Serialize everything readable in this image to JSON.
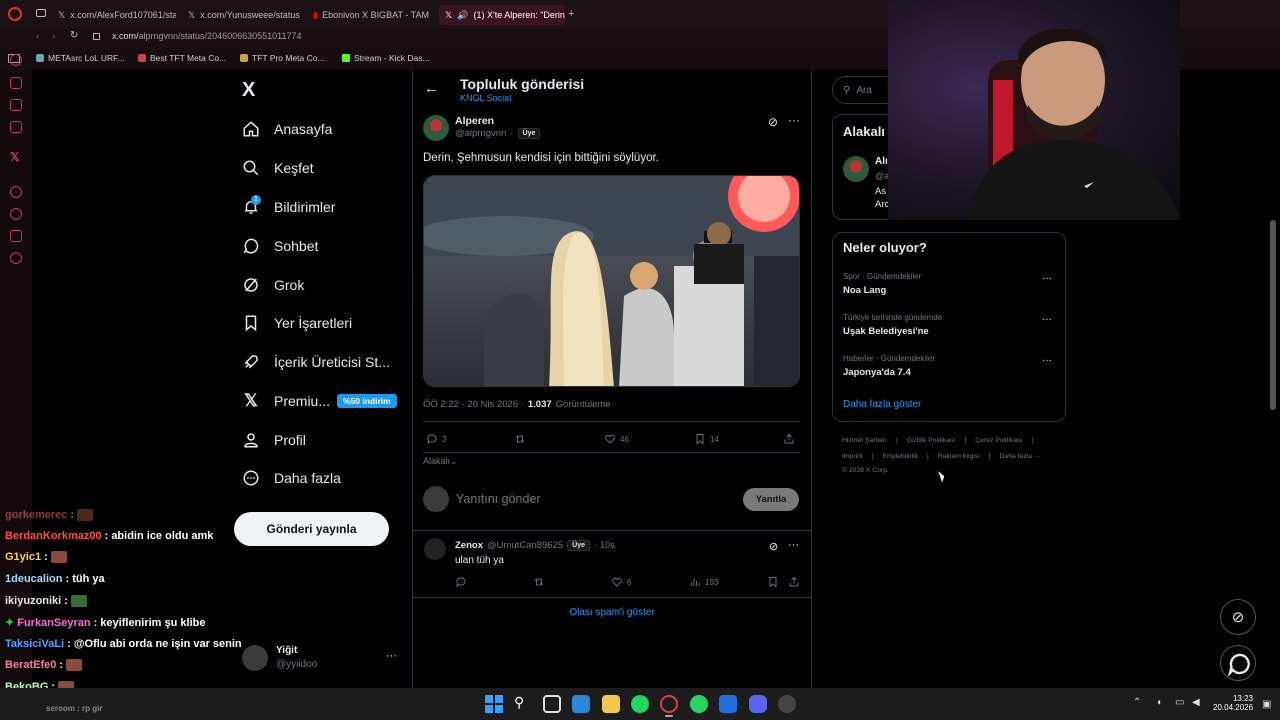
{
  "browser": {
    "tabs": [
      {
        "label": "x.com/AlexFord107061/sta"
      },
      {
        "label": "x.com/Yunusweee/status/"
      },
      {
        "label": "Ebonivon X BIGBAT - TAM"
      },
      {
        "label": "(1) X'te Alperen: \"Derin"
      }
    ],
    "url_prefix": "x.com/",
    "url_path": "alprngvnn/status/2046006630551011774",
    "bookmarks": [
      "METAsrc LoL URF...",
      "Best TFT Meta Co...",
      "TFT Pro Meta Co...",
      "Stream - Kick Das..."
    ]
  },
  "nav": {
    "logo": "X",
    "items": [
      {
        "label": "Anasayfa",
        "icon": "home-icon"
      },
      {
        "label": "Keşfet",
        "icon": "search-icon"
      },
      {
        "label": "Bildirimler",
        "icon": "bell-icon",
        "badge": "1"
      },
      {
        "label": "Sohbet",
        "icon": "chat-icon"
      },
      {
        "label": "Grok",
        "icon": "grok-icon"
      },
      {
        "label": "Yer İşaretleri",
        "icon": "bookmark-icon"
      },
      {
        "label": "İçerik Üreticisi St...",
        "icon": "rocket-icon"
      },
      {
        "label": "Premiu...",
        "icon": "x-icon",
        "badge": "%50 indirim"
      },
      {
        "label": "Profil",
        "icon": "profile-icon"
      },
      {
        "label": "Daha fazla",
        "icon": "more-circle-icon"
      }
    ],
    "post_button": "Gönderi yayınla",
    "account": {
      "name": "Yiğit",
      "handle": "@yyiidoo",
      "more": "···"
    }
  },
  "header": {
    "title": "Topluluk gönderisi",
    "community": "KNGL Social"
  },
  "post": {
    "author": "Alperen",
    "handle": "@alprngvnn",
    "dot": "·",
    "badge": "Üye",
    "text": "Derin, Şehmusun kendisi için bittiğini söylüyor.",
    "time": "ÖÖ 2:22 · 20 Nis 2026 ·",
    "views_count": "1.037",
    "views_label": "Görüntüleme",
    "replies": "3",
    "likes": "46",
    "bookmarks": "14",
    "sort_label": "Alakalı"
  },
  "reply_box": {
    "placeholder": "Yanıtını gönder",
    "button": "Yanıtla"
  },
  "reply": {
    "author": "Zenox",
    "handle": "@UmutCan89625",
    "badge": "Üye",
    "time": "· 10s",
    "text": "ulan tüh ya",
    "likes": "6",
    "views": "193"
  },
  "spam_link": "Olası spam'i göster",
  "right": {
    "search_placeholder": "Ara",
    "relevant_title": "Alakalı",
    "relevant_name": "Alı",
    "relevant_handle": "@a",
    "relevant_l1": "As",
    "relevant_l2": "Arc",
    "trends_title": "Neler oluyor?",
    "trends": [
      {
        "meta": "Spor · Gündemdekiler",
        "name": "Noa Lang"
      },
      {
        "meta": "Türkiye tarihinde gündemde",
        "name": "Uşak Belediyesi'ne"
      },
      {
        "meta": "Haberler · Gündemdekiler",
        "name": "Japonya'da 7.4"
      }
    ],
    "more_trends": "Daha fazla göster",
    "footer_row1": [
      "Hizmet Şartları",
      "|",
      "Gizlilik Politikası",
      "|",
      "Çerez Politikası",
      "|"
    ],
    "footer_row2": [
      "Imprint",
      "|",
      "Erişilebilirlik",
      "|",
      "Reklam bilgisi",
      "|",
      "Daha fazla ···"
    ],
    "copyright": "© 2026 X Corp."
  },
  "chat": [
    {
      "user": "gorkemerec",
      "msg": ":",
      "color": "#ff6a6a",
      "emote": true
    },
    {
      "user": "BerdanKorkmaz00",
      "msg": ": abidin ice oldu amk",
      "color": "#ff4d4d"
    },
    {
      "user": "G1yic1",
      "msg": ":",
      "color": "#ffd24d",
      "emote": true
    },
    {
      "user": "1deucalion",
      "msg": ": tüh ya",
      "color": "#a9d7ff"
    },
    {
      "user": "ikiyuzoniki",
      "msg": ":",
      "color": "#e7e7e7",
      "emote": true
    },
    {
      "user": "FurkanSeyran",
      "msg": ": keyiflenirim şu klibe",
      "color": "#ff6ad5"
    },
    {
      "user": "TaksiciVaLi",
      "msg": ": @Oflu abi orda ne işin var senin",
      "color": "#4da6ff"
    },
    {
      "user": "BeratEfe0",
      "msg": ":",
      "color": "#ff7aa8",
      "emote": true
    },
    {
      "user": "BekoBG",
      "msg": ":",
      "color": "#b6ffb0",
      "emote": true
    }
  ],
  "chat_footer": "seroom : rp gir",
  "clock": {
    "time": "13:23",
    "date": "20.04.2026"
  },
  "colors": {
    "accent": "#1d9bf0",
    "opera": "#c23b57",
    "background": "#000000"
  }
}
